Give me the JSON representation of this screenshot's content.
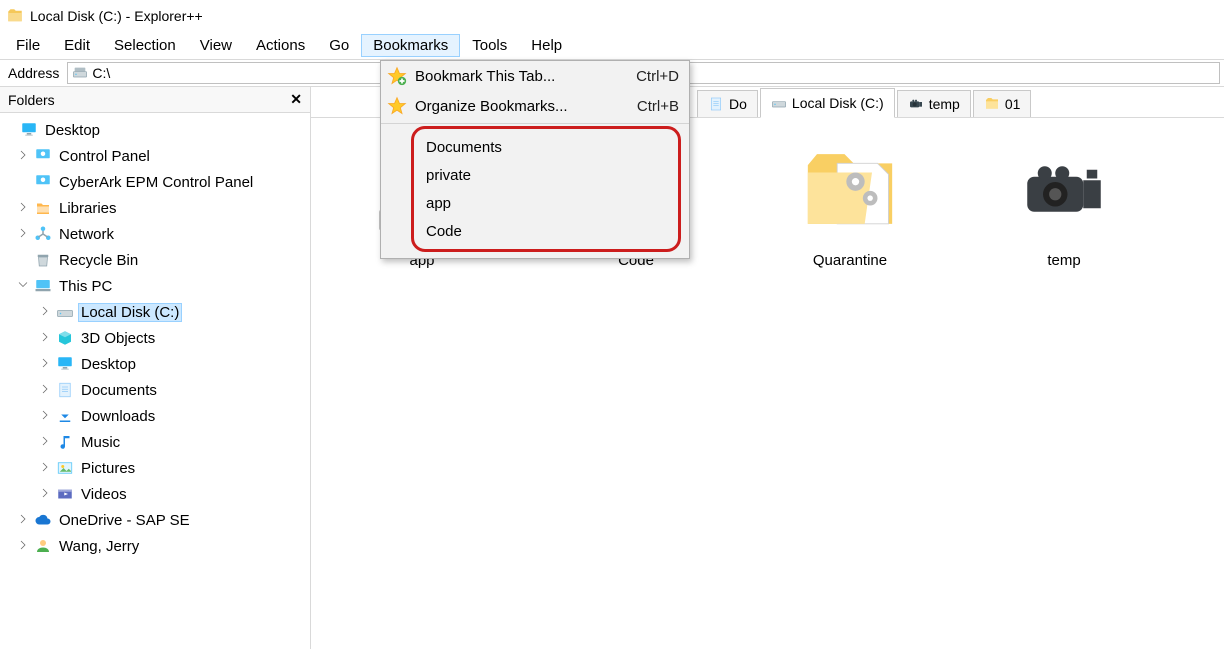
{
  "window": {
    "title": "Local Disk (C:) - Explorer++"
  },
  "menubar": {
    "items": [
      "File",
      "Edit",
      "Selection",
      "View",
      "Actions",
      "Go",
      "Bookmarks",
      "Tools",
      "Help"
    ],
    "open_index": 6
  },
  "address": {
    "label": "Address",
    "path": "C:\\"
  },
  "dropdown": {
    "actions": [
      {
        "label": "Bookmark This Tab...",
        "accel": "Ctrl+D"
      },
      {
        "label": "Organize Bookmarks...",
        "accel": "Ctrl+B"
      }
    ],
    "bookmarks": [
      "Documents",
      "private",
      "app",
      "Code"
    ]
  },
  "sidebar": {
    "title": "Folders",
    "nodes": [
      {
        "depth": 0,
        "expando": "",
        "icon": "monitor",
        "label": "Desktop",
        "sel": false
      },
      {
        "depth": 1,
        "expando": "right",
        "icon": "cpanel",
        "label": "Control Panel",
        "sel": false
      },
      {
        "depth": 1,
        "expando": "",
        "icon": "cpanel",
        "label": "CyberArk EPM Control Panel",
        "sel": false
      },
      {
        "depth": 1,
        "expando": "right",
        "icon": "libs",
        "label": "Libraries",
        "sel": false
      },
      {
        "depth": 1,
        "expando": "right",
        "icon": "network",
        "label": "Network",
        "sel": false
      },
      {
        "depth": 1,
        "expando": "",
        "icon": "recycle",
        "label": "Recycle Bin",
        "sel": false
      },
      {
        "depth": 1,
        "expando": "down",
        "icon": "pc",
        "label": "This PC",
        "sel": false
      },
      {
        "depth": 2,
        "expando": "right",
        "icon": "drive",
        "label": "Local Disk (C:)",
        "sel": true
      },
      {
        "depth": 2,
        "expando": "right",
        "icon": "3d",
        "label": "3D Objects",
        "sel": false
      },
      {
        "depth": 2,
        "expando": "right",
        "icon": "monitor",
        "label": "Desktop",
        "sel": false
      },
      {
        "depth": 2,
        "expando": "right",
        "icon": "doc",
        "label": "Documents",
        "sel": false
      },
      {
        "depth": 2,
        "expando": "right",
        "icon": "down",
        "label": "Downloads",
        "sel": false
      },
      {
        "depth": 2,
        "expando": "right",
        "icon": "music",
        "label": "Music",
        "sel": false
      },
      {
        "depth": 2,
        "expando": "right",
        "icon": "pic",
        "label": "Pictures",
        "sel": false
      },
      {
        "depth": 2,
        "expando": "right",
        "icon": "video",
        "label": "Videos",
        "sel": false
      },
      {
        "depth": 1,
        "expando": "right",
        "icon": "cloud",
        "label": "OneDrive - SAP SE",
        "sel": false
      },
      {
        "depth": 1,
        "expando": "right",
        "icon": "user",
        "label": "Wang, Jerry",
        "sel": false
      }
    ]
  },
  "tabs": [
    {
      "label": "Documents",
      "icon": "doc",
      "active": false,
      "truncated": true
    },
    {
      "label": "Local Disk (C:)",
      "icon": "drive",
      "active": true
    },
    {
      "label": "temp",
      "icon": "cam",
      "active": false
    },
    {
      "label": "01",
      "icon": "folder",
      "active": false
    }
  ],
  "files": [
    {
      "name": "app",
      "kind": "shortcut-folder"
    },
    {
      "name": "Code",
      "kind": "shortcut-folder"
    },
    {
      "name": "Quarantine",
      "kind": "folder-gear"
    },
    {
      "name": "temp",
      "kind": "camera"
    }
  ]
}
